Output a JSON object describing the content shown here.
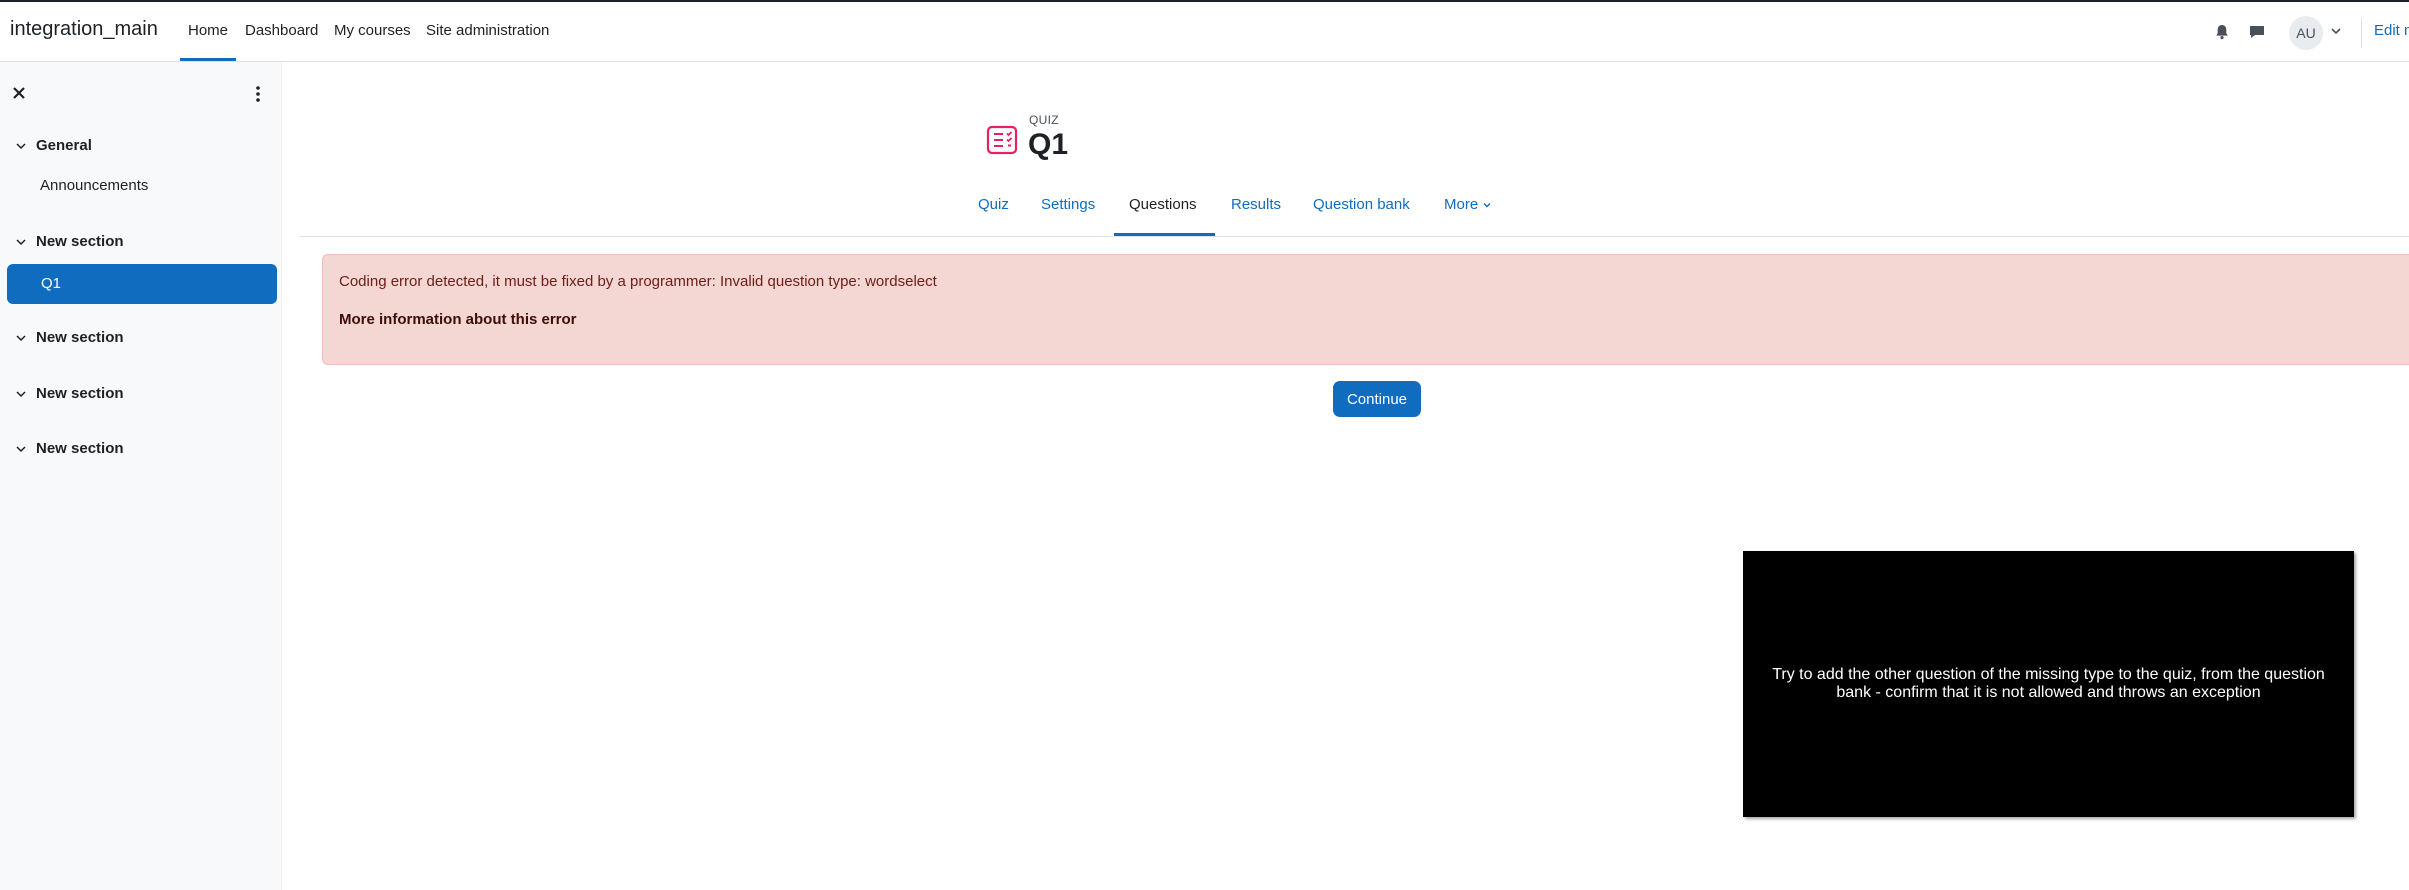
{
  "navbar": {
    "brand": "integration_main",
    "links": [
      "Home",
      "Dashboard",
      "My courses",
      "Site administration"
    ],
    "avatar_initials": "AU",
    "edit_mode_label": "Edit mode"
  },
  "drawer": {
    "sections": [
      {
        "title": "General",
        "items": [
          "Announcements"
        ]
      },
      {
        "title": "New section",
        "items": [
          "Q1"
        ]
      },
      {
        "title": "New section",
        "items": []
      },
      {
        "title": "New section",
        "items": []
      },
      {
        "title": "New section",
        "items": []
      }
    ]
  },
  "header": {
    "kicker": "QUIZ",
    "title": "Q1",
    "icon": "quiz-icon"
  },
  "tabs": [
    "Quiz",
    "Settings",
    "Questions",
    "Results",
    "Question bank",
    "More"
  ],
  "active_tab": "Questions",
  "alert": {
    "message": "Coding error detected, it must be fixed by a programmer: Invalid question type: wordselect",
    "more_link": "More information about this error"
  },
  "continue_label": "Continue",
  "overlay": {
    "text": "Try to add the other question of the missing type to the quiz, from the question bank - confirm that it is not allowed and throws an exception"
  },
  "colors": {
    "accent": "#0f6cbf",
    "alert_bg": "#f4d6d2",
    "alert_text": "#6e1d16",
    "quiz_icon": "#e91e63"
  }
}
